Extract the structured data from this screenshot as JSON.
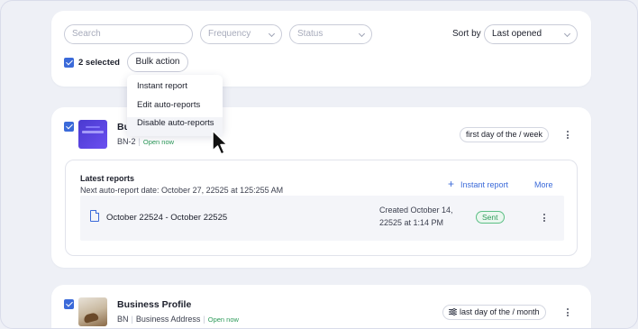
{
  "filters": {
    "search_placeholder": "Search",
    "frequency_placeholder": "Frequency",
    "status_placeholder": "Status",
    "sort_label": "Sort by",
    "sort_value": "Last opened",
    "selected_count": "2 selected",
    "bulk_action_label": "Bulk action"
  },
  "bulk_menu": {
    "items": [
      "Instant report",
      "Edit auto-reports",
      "Disable auto-reports"
    ]
  },
  "business1": {
    "title": "Bu",
    "code": "BN-2",
    "status": "Open now",
    "frequency": "first day of the / week",
    "reports": {
      "title": "Latest reports",
      "next_date": "Next auto-report date: October 27, 22525 at 125:255 AM",
      "instant_link": "Instant report",
      "more_link": "More",
      "row": {
        "range": "October 22524 - October 22525",
        "created_line1": "Created October 14,",
        "created_line2": "22525 at 1:14 PM",
        "status": "Sent"
      }
    }
  },
  "business2": {
    "title": "Business Profile",
    "code": "BN",
    "address": "Business Address",
    "status": "Open now",
    "frequency": "last day of the / month"
  },
  "colors": {
    "accent": "#3b6ad9",
    "success": "#2e9b5a"
  },
  "icons": {
    "plus": "plus-icon",
    "doc": "document-icon",
    "tune": "sliders-icon",
    "kebab": "more-vertical-icon"
  }
}
